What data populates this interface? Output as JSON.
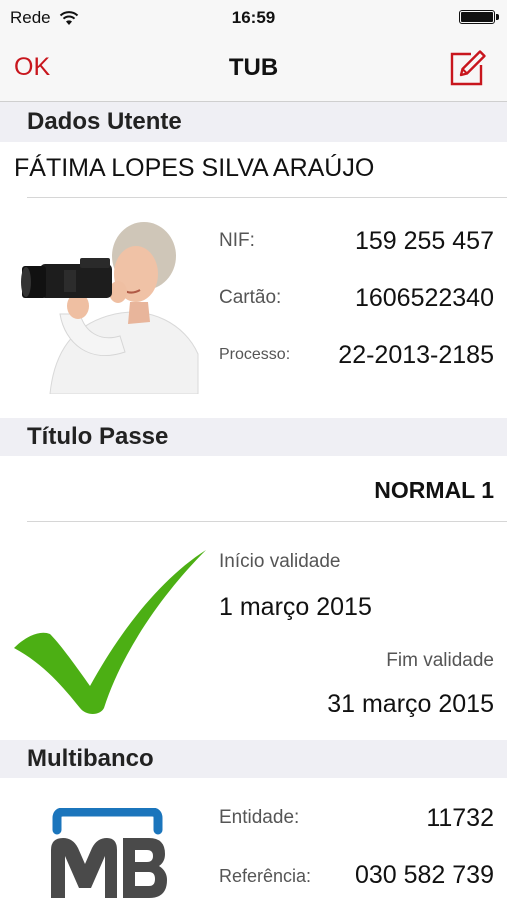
{
  "status_bar": {
    "carrier": "Rede",
    "time": "16:59",
    "battery_level": 1.0,
    "wifi_icon": "wifi-icon",
    "battery_icon": "battery-icon"
  },
  "nav": {
    "ok_label": "OK",
    "title": "TUB",
    "edit_icon": "compose-icon"
  },
  "colors": {
    "accent": "#c8161d",
    "section_bg": "#efeff4",
    "check_green": "#4caf14",
    "mb_blue": "#1b75bc",
    "mb_gray": "#4a4a4a"
  },
  "dados_utente": {
    "header": "Dados Utente",
    "name": "FÁTIMA LOPES SILVA ARAÚJO",
    "nif_label": "NIF:",
    "nif_value": "159 255 457",
    "cartao_label": "Cartão:",
    "cartao_value": "1606522340",
    "processo_label": "Processo:",
    "processo_value": "22-2013-2185"
  },
  "titulo_passe": {
    "header": "Título Passe",
    "type": "NORMAL 1",
    "inicio_label": "Início validade",
    "inicio_value": "1 março 2015",
    "fim_label": "Fim validade",
    "fim_value": "31 março 2015",
    "status_icon": "checkmark-icon"
  },
  "multibanco": {
    "header": "Multibanco",
    "logo": "multibanco-logo",
    "entidade_label": "Entidade:",
    "entidade_value": "11732",
    "referencia_label": "Referência:",
    "referencia_value": "030 582 739"
  }
}
